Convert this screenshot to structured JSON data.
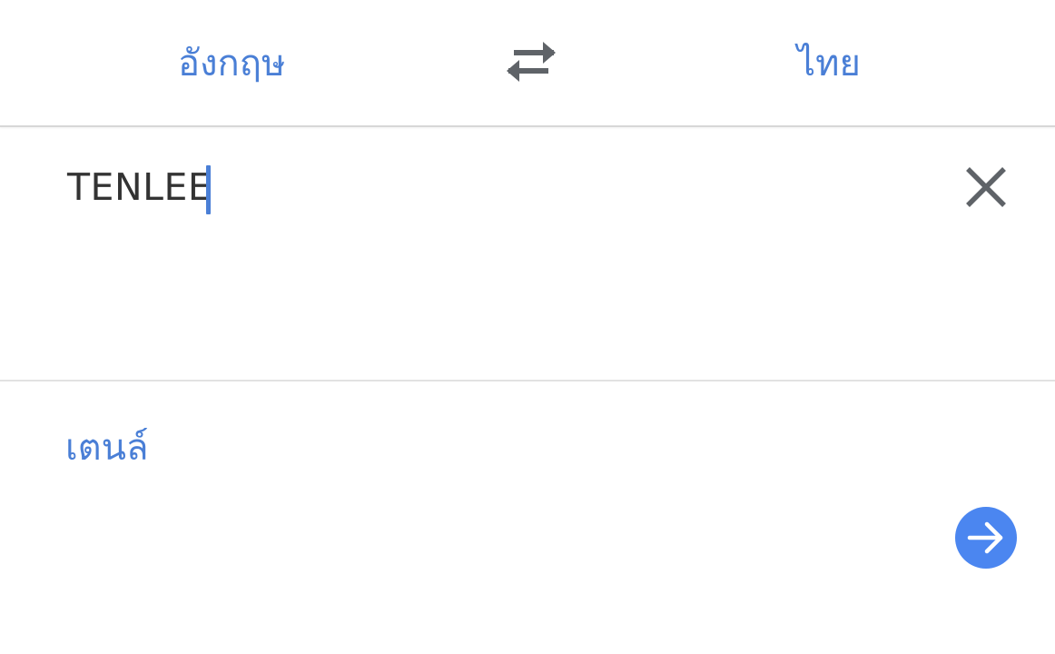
{
  "languages": {
    "source_label": "อังกฤษ",
    "target_label": "ไทย"
  },
  "input": {
    "value": "TENLEE"
  },
  "result": {
    "text": "เตนล์"
  },
  "icons": {
    "swap": "swap-arrows-icon",
    "clear": "close-icon",
    "submit": "arrow-right-icon"
  },
  "colors": {
    "accent": "#4a7fd6",
    "submit_button": "#4b86f0",
    "icon_gray": "#5f6368",
    "input_text": "#333333"
  }
}
